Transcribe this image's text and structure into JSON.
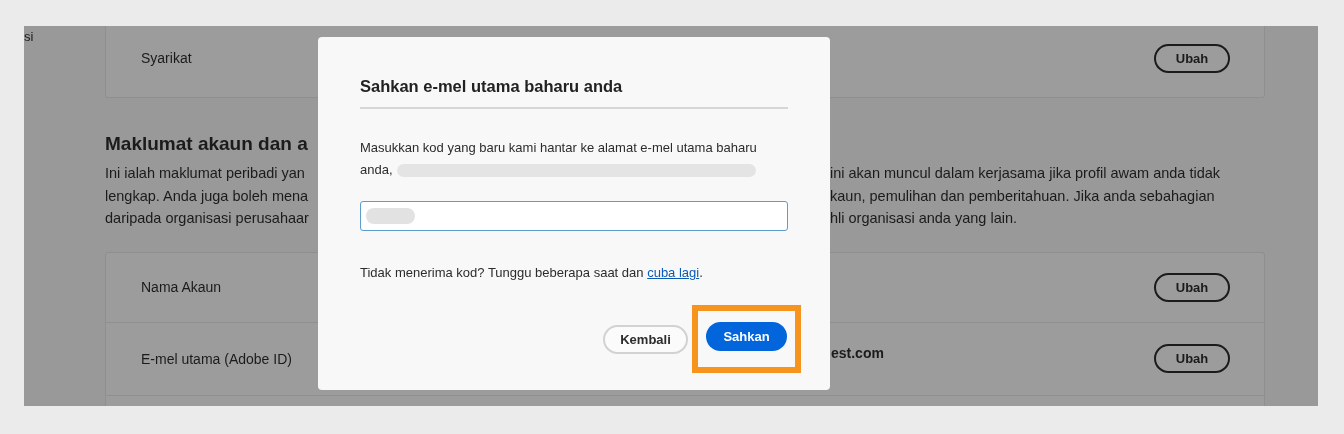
{
  "background_page": {
    "corner_text": "si",
    "company_row": {
      "label": "Syarikat",
      "button": "Ubah"
    },
    "section_heading": "Maklumat akaun dan a",
    "description_left": [
      "Ini ialah maklumat peribadi yan",
      "lengkap. Anda juga boleh mena",
      "daripada organisasi perusahaar"
    ],
    "description_right": [
      "ini akan muncul dalam kerjasama jika profil awam anda tidak",
      "kaun, pemulihan dan pemberitahuan. Jika anda sebahagian",
      "hli organisasi anda yang lain."
    ],
    "account_rows": [
      {
        "label": "Nama Akaun",
        "button": "Ubah"
      },
      {
        "label": "E-mel utama (Adobe ID)",
        "value": "est.com",
        "button": "Ubah"
      }
    ]
  },
  "dialog": {
    "title": "Sahkan e-mel utama baharu anda",
    "message": "Masukkan kod yang baru kami hantar ke alamat e-mel utama baharu anda,",
    "email_redacted": true,
    "code_field": {
      "value_redacted": true
    },
    "resend_text": "Tidak menerima kod? Tunggu beberapa saat dan",
    "resend_link": "cuba lagi",
    "resend_end": ".",
    "buttons": [
      {
        "label": "Kembali",
        "kind": "secondary",
        "highlighted": false
      },
      {
        "label": "Sahkan",
        "kind": "primary",
        "highlighted": true
      }
    ]
  }
}
